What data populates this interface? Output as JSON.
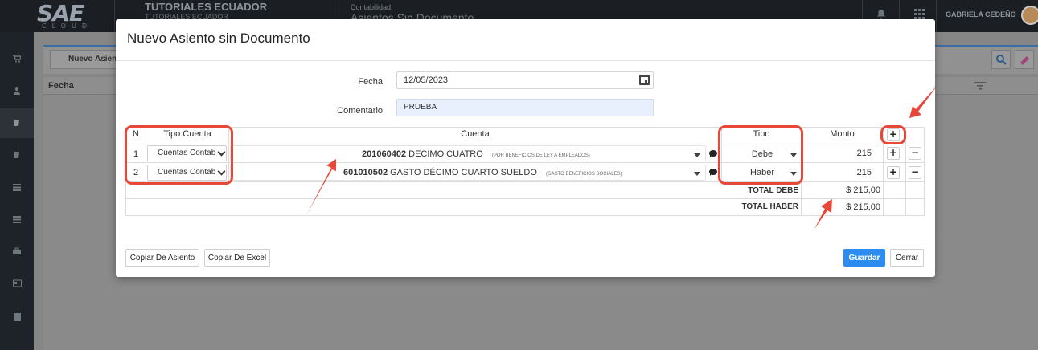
{
  "app": {
    "logo_main": "SAE",
    "logo_sub": "CLOUD",
    "company_name": "TUTORIALES ECUADOR",
    "company_sub": "TUTORIALES ECUADOR",
    "module_section": "Contabilidad",
    "module_title": "Asientos Sin Documento",
    "user_name": "GABRIELA CEDEÑO"
  },
  "background": {
    "tab_label": "Nuevo Asien",
    "column_header": "Fecha"
  },
  "modal": {
    "title": "Nuevo Asiento sin Documento",
    "fecha_label": "Fecha",
    "fecha_value": "12/05/2023",
    "comentario_label": "Comentario",
    "comentario_value": "PRUEBA",
    "table": {
      "headers": {
        "n": "N",
        "tipo_cuenta": "Tipo Cuenta",
        "cuenta": "Cuenta",
        "tipo": "Tipo",
        "monto": "Monto",
        "add": "+"
      },
      "rows": [
        {
          "n": "1",
          "tipo_cuenta": "Cuentas Contab",
          "cuenta_code": "201060402",
          "cuenta_name": "DECIMO CUATRO",
          "cuenta_note": "(POR BENEFICIOS DE LEY A EMPLEADOS)",
          "tipo": "Debe",
          "monto": "215",
          "add": "+",
          "remove": "−"
        },
        {
          "n": "2",
          "tipo_cuenta": "Cuentas Contab",
          "cuenta_code": "601010502",
          "cuenta_name": "GASTO DÉCIMO CUARTO SUELDO",
          "cuenta_note": "(GASTO BENEFICIOS SOCIALES)",
          "tipo": "Haber",
          "monto": "215",
          "add": "+",
          "remove": "−"
        }
      ],
      "total_debe_label": "TOTAL DEBE",
      "total_debe_value": "$ 215,00",
      "total_haber_label": "TOTAL HABER",
      "total_haber_value": "$ 215,00"
    },
    "buttons": {
      "copy_asiento": "Copiar De Asiento",
      "copy_excel": "Copiar De Excel",
      "save": "Guardar",
      "close": "Cerrar"
    }
  },
  "colors": {
    "highlight": "#e8483a",
    "primary_button": "#2d8cf0",
    "comment_field_bg": "#e8f0fe"
  },
  "icons": [
    "calendar-icon",
    "comment-icon",
    "chevron-down-icon",
    "caret-down-icon",
    "plus-icon",
    "minus-icon",
    "bell-icon",
    "grid-icon",
    "search-icon",
    "eraser-icon"
  ]
}
